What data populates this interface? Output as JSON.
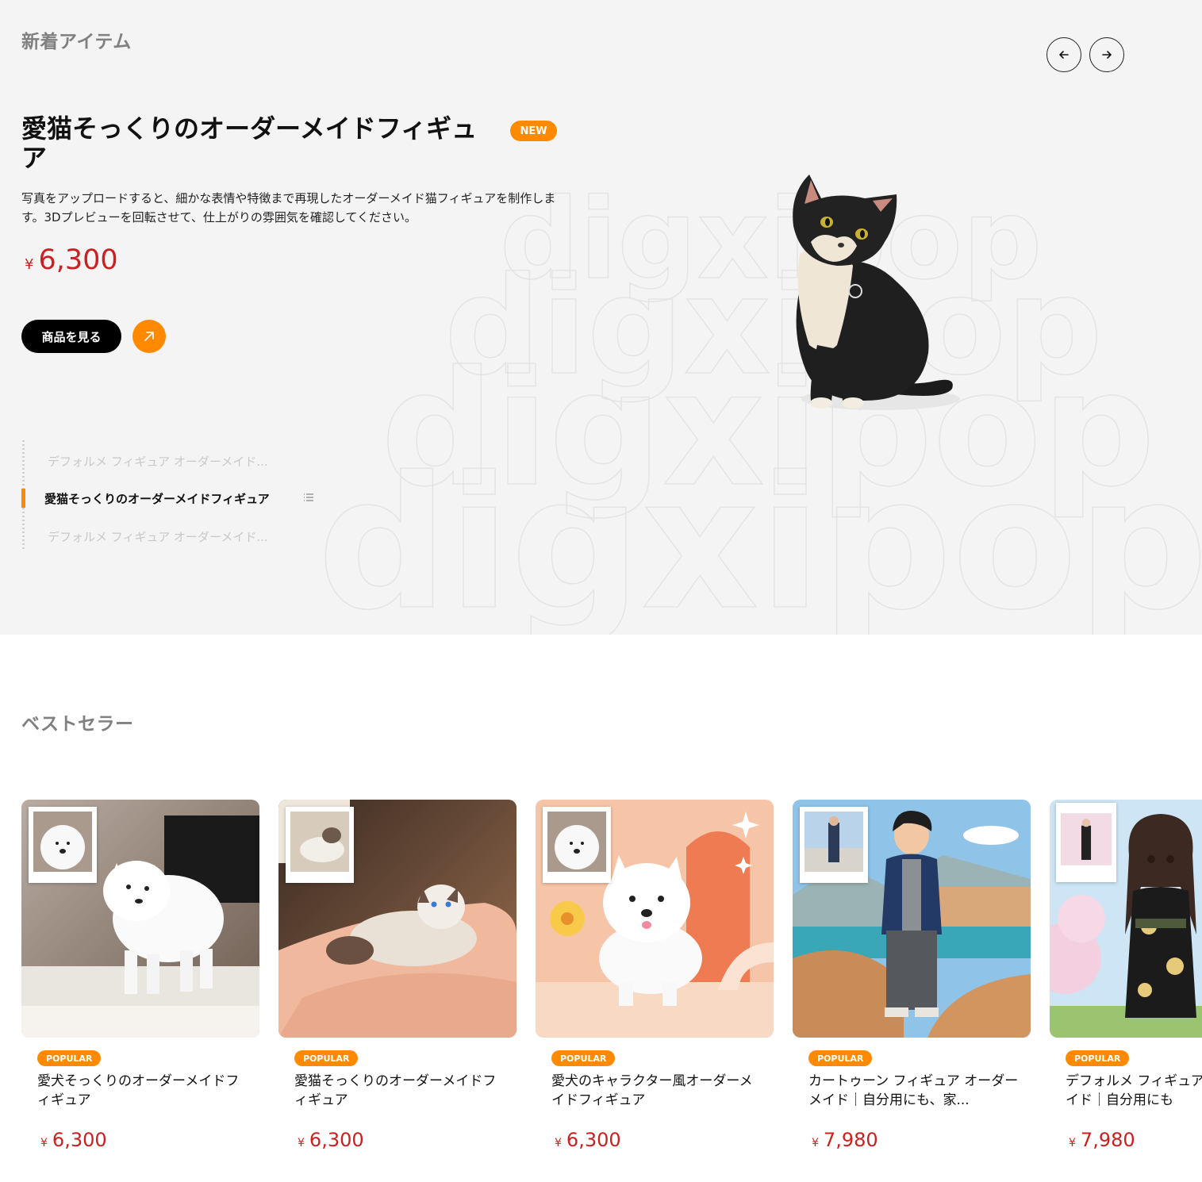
{
  "new_items": {
    "section_title": "新着アイテム",
    "featured": {
      "badge": "NEW",
      "title": "愛猫そっくりのオーダーメイドフィギュア",
      "description": "写真をアップロードすると、細かな表情や特徴まで再現したオーダーメイド猫フィギュアを制作します。3Dプレビューを回転させて、仕上がりの雰囲気を確認してください。",
      "currency": "¥",
      "price": "6,300",
      "cta_label": "商品を見る"
    },
    "thumbnails": [
      {
        "label": "デフォルメ フィギュア オーダーメイド...",
        "active": false
      },
      {
        "label": "愛猫そっくりのオーダーメイドフィギュア",
        "active": true
      },
      {
        "label": "デフォルメ フィギュア オーダーメイド...",
        "active": false
      }
    ],
    "watermark_text": "digxipop",
    "icons": {
      "prev": "arrow-left-icon",
      "next": "arrow-right-icon",
      "cta": "arrow-up-right-icon",
      "list": "list-icon"
    }
  },
  "best_sellers": {
    "section_title": "ベストセラー",
    "products": [
      {
        "badge": "POPULAR",
        "name": "愛犬そっくりのオーダーメイドフィギュア",
        "currency": "¥",
        "price": "6,300"
      },
      {
        "badge": "POPULAR",
        "name": "愛猫そっくりのオーダーメイドフィギュア",
        "currency": "¥",
        "price": "6,300"
      },
      {
        "badge": "POPULAR",
        "name": "愛犬のキャラクター風オーダーメイドフィギュア",
        "currency": "¥",
        "price": "6,300"
      },
      {
        "badge": "POPULAR",
        "name": "カートゥーン フィギュア オーダーメイド｜自分用にも、家...",
        "currency": "¥",
        "price": "7,980"
      },
      {
        "badge": "POPULAR",
        "name": "デフォルメ フィギュア オーダーメイド｜自分用にも",
        "currency": "¥",
        "price": "7,980"
      }
    ]
  },
  "colors": {
    "accent": "#ff8a00",
    "price": "#cc1f1f",
    "hero_bg": "#f4f4f4",
    "heading_muted": "#808080"
  }
}
